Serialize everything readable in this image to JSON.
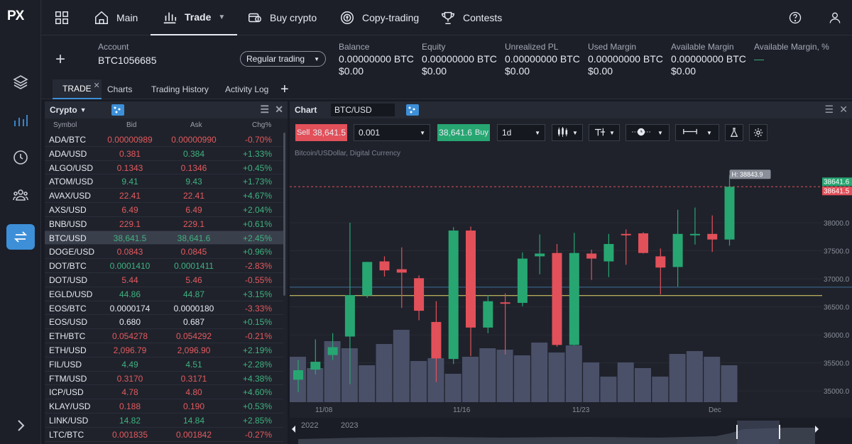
{
  "brand": {
    "logo": "PX"
  },
  "nav": {
    "items": [
      {
        "label": "Main",
        "icon": "home-icon"
      },
      {
        "label": "Trade",
        "icon": "bar-chart-icon"
      },
      {
        "label": "Buy crypto",
        "icon": "card-icon"
      },
      {
        "label": "Copy-trading",
        "icon": "copy-trading-icon"
      },
      {
        "label": "Contests",
        "icon": "trophy-icon"
      }
    ]
  },
  "account": {
    "label": "Account",
    "id": "BTC1056685",
    "mode": "Regular trading",
    "stats": [
      {
        "label": "Balance",
        "btc": "0.00000000 BTC",
        "usd": "$0.00"
      },
      {
        "label": "Equity",
        "btc": "0.00000000 BTC",
        "usd": "$0.00"
      },
      {
        "label": "Unrealized PL",
        "btc": "0.00000000 BTC",
        "usd": "$0.00"
      },
      {
        "label": "Used Margin",
        "btc": "0.00000000 BTC",
        "usd": "$0.00"
      },
      {
        "label": "Available Margin",
        "btc": "0.00000000 BTC",
        "usd": "$0.00"
      },
      {
        "label": "Available Margin, %",
        "btc": "—",
        "usd": ""
      }
    ]
  },
  "tabs": [
    "TRADE",
    "Charts",
    "Trading History",
    "Activity Log"
  ],
  "watchlist": {
    "title": "Crypto",
    "columns": [
      "Symbol",
      "Bid",
      "Ask",
      "Chg%"
    ],
    "rows": [
      {
        "symbol": "ADA/BTC",
        "bid": "0.00000989",
        "ask": "0.00000990",
        "chg": "-0.70%",
        "color": "red"
      },
      {
        "symbol": "ADA/USD",
        "bid": "0.381",
        "ask": "0.384",
        "chg": "+1.33%",
        "color": "mixed"
      },
      {
        "symbol": "ALGO/USD",
        "bid": "0.1343",
        "ask": "0.1346",
        "chg": "+0.45%",
        "color": "red"
      },
      {
        "symbol": "ATOM/USD",
        "bid": "9.41",
        "ask": "9.43",
        "chg": "+1.73%",
        "color": "green"
      },
      {
        "symbol": "AVAX/USD",
        "bid": "22.41",
        "ask": "22.41",
        "chg": "+4.67%",
        "color": "red"
      },
      {
        "symbol": "AXS/USD",
        "bid": "6.49",
        "ask": "6.49",
        "chg": "+2.04%",
        "color": "red"
      },
      {
        "symbol": "BNB/USD",
        "bid": "229.1",
        "ask": "229.1",
        "chg": "+0.61%",
        "color": "red"
      },
      {
        "symbol": "BTC/USD",
        "bid": "38,641.5",
        "ask": "38,641.6",
        "chg": "+2.45%",
        "color": "green"
      },
      {
        "symbol": "DOGE/USD",
        "bid": "0.0843",
        "ask": "0.0845",
        "chg": "+0.96%",
        "color": "red"
      },
      {
        "symbol": "DOT/BTC",
        "bid": "0.0001410",
        "ask": "0.0001411",
        "chg": "-2.83%",
        "color": "green"
      },
      {
        "symbol": "DOT/USD",
        "bid": "5.44",
        "ask": "5.46",
        "chg": "-0.55%",
        "color": "red"
      },
      {
        "symbol": "EGLD/USD",
        "bid": "44.86",
        "ask": "44.87",
        "chg": "+3.15%",
        "color": "green"
      },
      {
        "symbol": "EOS/BTC",
        "bid": "0.0000174",
        "ask": "0.0000180",
        "chg": "-3.33%",
        "color": "white"
      },
      {
        "symbol": "EOS/USD",
        "bid": "0.680",
        "ask": "0.687",
        "chg": "+0.15%",
        "color": "white"
      },
      {
        "symbol": "ETH/BTC",
        "bid": "0.054278",
        "ask": "0.054292",
        "chg": "-0.21%",
        "color": "red"
      },
      {
        "symbol": "ETH/USD",
        "bid": "2,096.79",
        "ask": "2,096.90",
        "chg": "+2.19%",
        "color": "red"
      },
      {
        "symbol": "FIL/USD",
        "bid": "4.49",
        "ask": "4.51",
        "chg": "+2.28%",
        "color": "green"
      },
      {
        "symbol": "FTM/USD",
        "bid": "0.3170",
        "ask": "0.3171",
        "chg": "+4.38%",
        "color": "red"
      },
      {
        "symbol": "ICP/USD",
        "bid": "4.78",
        "ask": "4.80",
        "chg": "+4.60%",
        "color": "red"
      },
      {
        "symbol": "KLAY/USD",
        "bid": "0.188",
        "ask": "0.190",
        "chg": "+0.53%",
        "color": "red"
      },
      {
        "symbol": "LINK/USD",
        "bid": "14.82",
        "ask": "14.84",
        "chg": "+2.85%",
        "color": "green"
      },
      {
        "symbol": "LTC/BTC",
        "bid": "0.001835",
        "ask": "0.001842",
        "chg": "-0.27%",
        "color": "red"
      }
    ]
  },
  "chart": {
    "panel_title": "Chart",
    "symbol": "BTC/USD",
    "sell_label": "Sell",
    "sell_price": "38,641.5",
    "buy_label": "Buy",
    "buy_price": "38,641.6",
    "quantity": "0.001",
    "timeframe": "1d",
    "instrument_desc": "Bitcoin/USDollar, Digital Currency",
    "high_label": "H: 38843.9",
    "price_tag_buy": "38641.6",
    "price_tag_sell": "38641.5",
    "navigator_years": [
      "2022",
      "2023"
    ]
  },
  "chart_data": {
    "type": "candlestick",
    "x_ticks": [
      "11/08",
      "11/16",
      "11/23",
      "Dec"
    ],
    "y_ticks": [
      38000,
      37500,
      37000,
      36500,
      36000,
      35500,
      35000
    ],
    "ylim": [
      34800,
      39100
    ],
    "candles": [
      {
        "o": 35200,
        "h": 35550,
        "l": 34980,
        "c": 35370
      },
      {
        "o": 35380,
        "h": 35920,
        "l": 35290,
        "c": 35520
      },
      {
        "o": 35640,
        "h": 36030,
        "l": 35550,
        "c": 35780
      },
      {
        "o": 35970,
        "h": 38000,
        "l": 35120,
        "c": 36710
      },
      {
        "o": 36700,
        "h": 37300,
        "l": 36660,
        "c": 37300
      },
      {
        "o": 37310,
        "h": 37400,
        "l": 37040,
        "c": 37150
      },
      {
        "o": 37170,
        "h": 37560,
        "l": 36480,
        "c": 37110
      },
      {
        "o": 37010,
        "h": 37060,
        "l": 36260,
        "c": 36430
      },
      {
        "o": 36230,
        "h": 36600,
        "l": 35160,
        "c": 35580
      },
      {
        "o": 35570,
        "h": 37920,
        "l": 35480,
        "c": 37860
      },
      {
        "o": 37860,
        "h": 37930,
        "l": 35620,
        "c": 36130
      },
      {
        "o": 36130,
        "h": 36710,
        "l": 36030,
        "c": 36600
      },
      {
        "o": 36580,
        "h": 36740,
        "l": 35650,
        "c": 36560
      },
      {
        "o": 36570,
        "h": 37470,
        "l": 36510,
        "c": 37360
      },
      {
        "o": 37400,
        "h": 37790,
        "l": 37080,
        "c": 37450
      },
      {
        "o": 37460,
        "h": 37620,
        "l": 35790,
        "c": 35820
      },
      {
        "o": 35820,
        "h": 37820,
        "l": 35810,
        "c": 37460
      },
      {
        "o": 37450,
        "h": 37520,
        "l": 36980,
        "c": 37360
      },
      {
        "o": 37310,
        "h": 37800,
        "l": 37030,
        "c": 37620
      },
      {
        "o": 37800,
        "h": 37880,
        "l": 37250,
        "c": 37790
      },
      {
        "o": 37810,
        "h": 37830,
        "l": 37450,
        "c": 37460
      },
      {
        "o": 37400,
        "h": 37540,
        "l": 36720,
        "c": 37200
      },
      {
        "o": 37210,
        "h": 38230,
        "l": 36860,
        "c": 37800
      },
      {
        "o": 37780,
        "h": 38270,
        "l": 37610,
        "c": 37800
      },
      {
        "o": 37800,
        "h": 38130,
        "l": 37480,
        "c": 37700
      },
      {
        "o": 37700,
        "h": 38844,
        "l": 37590,
        "c": 38641
      }
    ],
    "volume": [
      32,
      24,
      43,
      38,
      26,
      41,
      51,
      29,
      31,
      20,
      32,
      38,
      37,
      33,
      42,
      35,
      40,
      28,
      18,
      28,
      24,
      18,
      34,
      36,
      32,
      26
    ],
    "lines": {
      "h_line_yellow": 36700,
      "h_line_blue": 36850,
      "h_line_red": 38641
    },
    "colors": {
      "up": "#27a672",
      "down": "#e2505a",
      "volume": "#4a5068"
    }
  }
}
